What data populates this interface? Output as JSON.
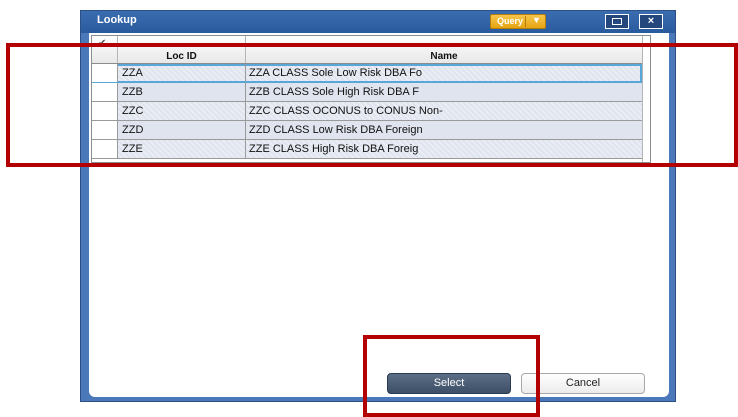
{
  "dialog": {
    "title": "Lookup",
    "query_label": "Query",
    "query_arrow": "▼",
    "maximize_icon": "maximize-icon",
    "close_icon": "×"
  },
  "grid": {
    "columns": [
      "",
      "Loc ID",
      "Name"
    ],
    "header_check": "✔",
    "rows": [
      {
        "loc_id": "ZZA",
        "name": "ZZA CLASS Sole Low Risk DBA Fo"
      },
      {
        "loc_id": "ZZB",
        "name": "ZZB CLASS Sole High Risk DBA F"
      },
      {
        "loc_id": "ZZC",
        "name": "ZZC CLASS OCONUS to CONUS Non-"
      },
      {
        "loc_id": "ZZD",
        "name": "ZZD CLASS Low Risk DBA Foreign"
      },
      {
        "loc_id": "ZZE",
        "name": "ZZE CLASS High Risk DBA Foreig"
      }
    ]
  },
  "buttons": {
    "select_label": "Select",
    "cancel_label": "Cancel"
  },
  "colors": {
    "titlebar": "#2a5a9e",
    "query": "#e6a414",
    "highlight": "#b30000",
    "row_bg": "#dfe4ee",
    "select_button": "#3d4f67"
  }
}
